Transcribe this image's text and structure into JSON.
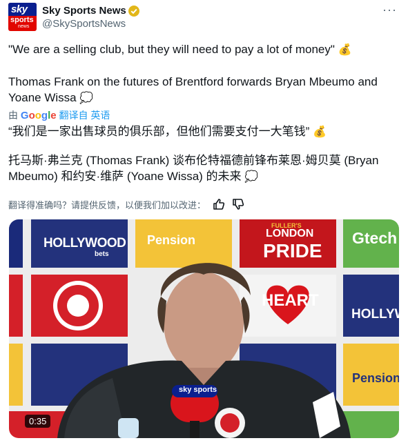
{
  "account": {
    "name": "Sky Sports News",
    "handle": "@SkySportsNews",
    "avatar": {
      "line1": "sky",
      "line2": "sports",
      "line3": "news"
    },
    "verified_color": "#e2b719"
  },
  "tweet": {
    "line1": "\"We are a selling club, but they will need to pay a lot of money\"",
    "line2": "Thomas Frank on the futures of Brentford forwards Bryan Mbeumo and Yoane Wissa",
    "emoji_money": "💰",
    "emoji_boom": "💭"
  },
  "translation": {
    "prefix": "由",
    "provider": "Google",
    "suffix": "翻译自 英语",
    "zh_line1": "“我们是一家出售球员的俱乐部，但他们需要支付一大笔钱”",
    "zh_line2": "托马斯·弗兰克 (Thomas Frank) 谈布伦特福德前锋布莱恩·姆贝莫 (Bryan Mbeumo) 和约安·维萨 (Yoane Wissa) 的未来"
  },
  "feedback": {
    "prompt": "翻译得准确吗？请提供反馈，以便我们加以改进："
  },
  "media": {
    "duration": "0:35",
    "board_text": {
      "hollywood": "HOLLYWOOD",
      "bets": "bets",
      "pension": "Pension",
      "london": "LONDON",
      "pride": "PRIDE",
      "fullers": "FULLER'S",
      "gtech": "Gtech",
      "heart": "HEART",
      "hollyw": "HOLLYW",
      "mic_label": "sky sports"
    }
  }
}
